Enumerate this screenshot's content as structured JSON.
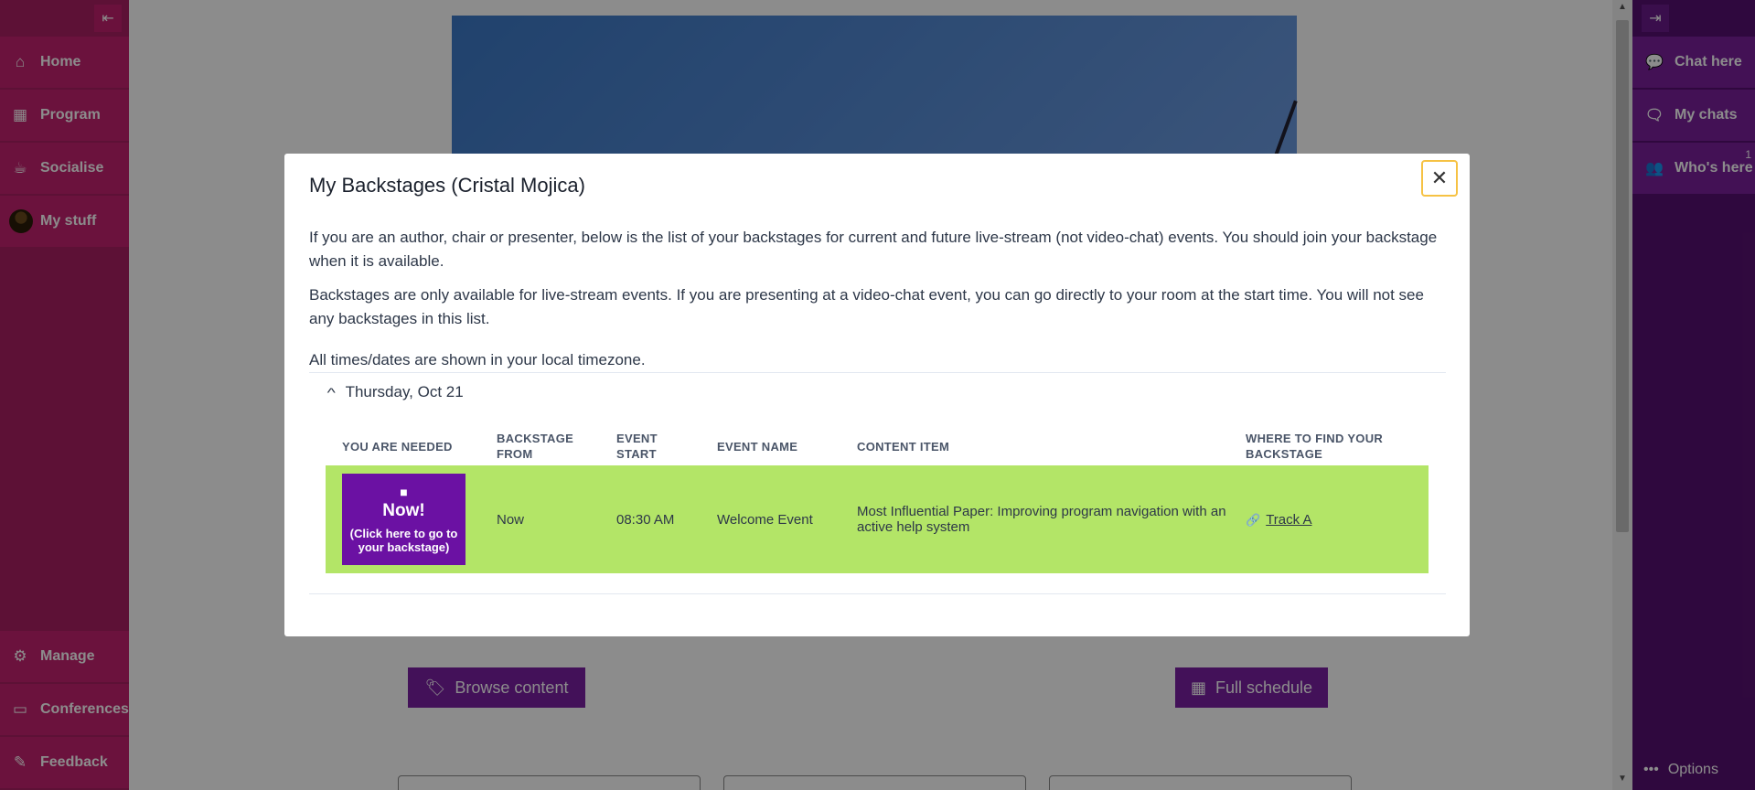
{
  "left_sidebar": {
    "collapse_icon": "collapse-left-icon",
    "items": [
      {
        "label": "Home",
        "icon": "home-icon"
      },
      {
        "label": "Program",
        "icon": "calendar-icon"
      },
      {
        "label": "Socialise",
        "icon": "coffee-icon"
      },
      {
        "label": "My stuff",
        "icon": "avatar"
      }
    ],
    "bottom_items": [
      {
        "label": "Manage",
        "icon": "gear-icon"
      },
      {
        "label": "Conferences",
        "icon": "keyboard-icon"
      },
      {
        "label": "Feedback",
        "icon": "feedback-icon"
      }
    ]
  },
  "right_sidebar": {
    "expand_icon": "expand-right-icon",
    "items": [
      {
        "label": "Chat here",
        "icon": "chat-icon"
      },
      {
        "label": "My chats",
        "icon": "chats-icon"
      },
      {
        "label": "Who's here",
        "icon": "users-icon",
        "badge": "1"
      }
    ],
    "options_label": "Options"
  },
  "main": {
    "browse_label": "Browse content",
    "schedule_label": "Full schedule"
  },
  "modal": {
    "title": "My Backstages (Cristal Mojica)",
    "intro": "If you are an author, chair or presenter, below is the list of your backstages for current and future live-stream (not video-chat) events. You should join your backstage when it is available.",
    "note": "Backstages are only available for live-stream events. If you are presenting at a video-chat event, you can go directly to your room at the start time. You will not see any backstages in this list.",
    "timezone_note": "All times/dates are shown in your local timezone.",
    "day_label": "Thursday, Oct 21",
    "columns": {
      "needed": "YOU ARE NEEDED",
      "backstage_from": "BACKSTAGE FROM",
      "event_start": "EVENT START",
      "event_name": "EVENT NAME",
      "content_item": "CONTENT ITEM",
      "where": "WHERE TO FIND YOUR BACKSTAGE"
    },
    "row": {
      "now_label": "Now!",
      "now_sub": "(Click here to go to your backstage)",
      "backstage_from": "Now",
      "event_start": "08:30 AM",
      "event_name": "Welcome Event",
      "content_item": "Most Influential Paper: Improving program navigation with an active help system",
      "where": "Track A"
    },
    "colors": {
      "row_bg": "#b3e567",
      "now_button": "#6b11a3",
      "close_border": "#f6c244"
    }
  }
}
